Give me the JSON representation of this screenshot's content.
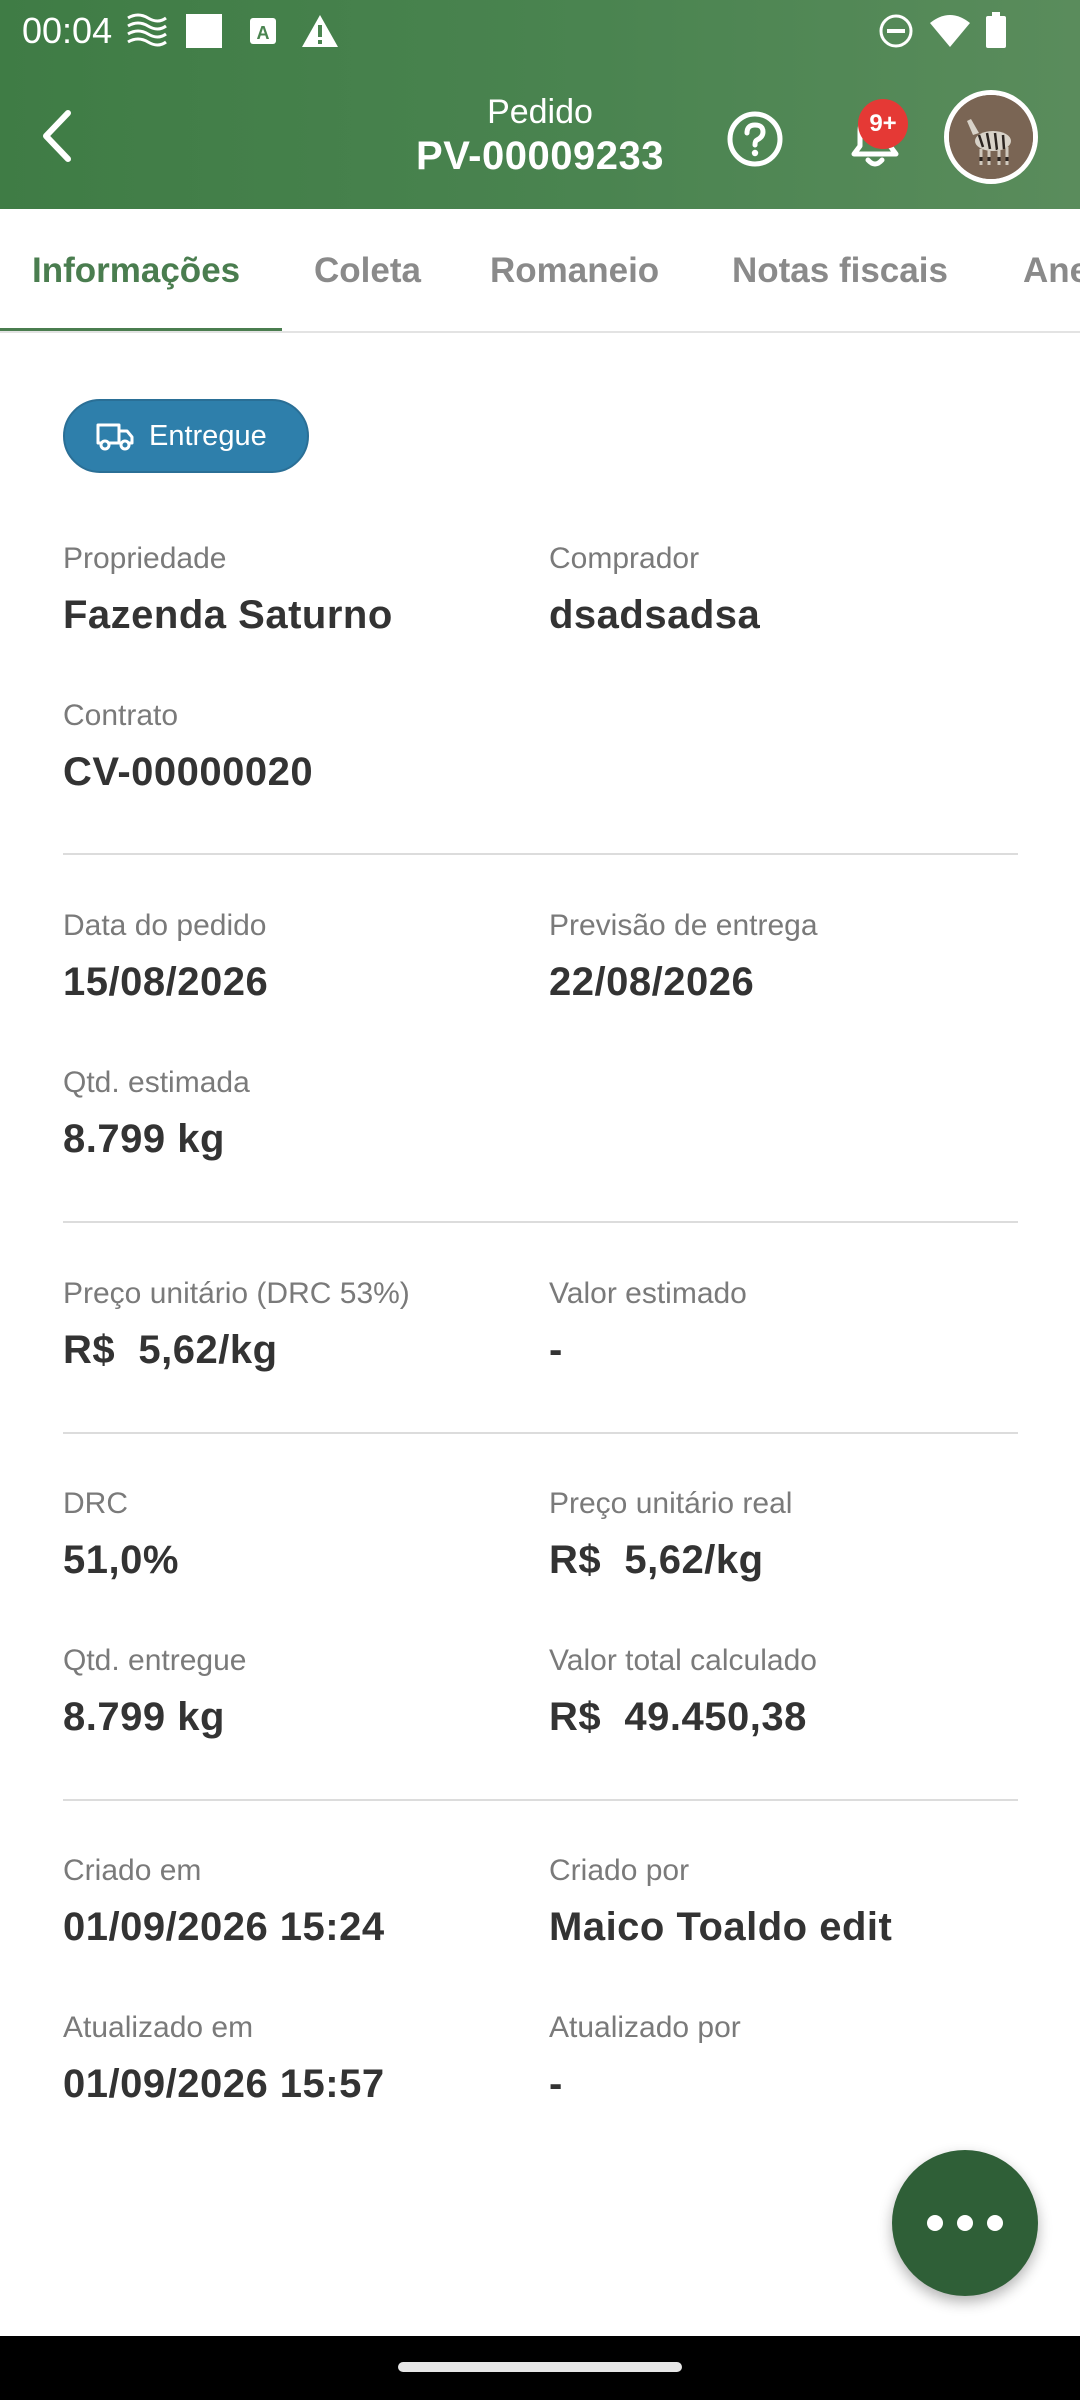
{
  "status_bar": {
    "time": "00:04"
  },
  "app_bar": {
    "title_small": "Pedido",
    "title_main": "PV-00009233",
    "notification_badge": "9+"
  },
  "tabs": [
    {
      "label": "Informações",
      "active": true
    },
    {
      "label": "Coleta",
      "active": false
    },
    {
      "label": "Romaneio",
      "active": false
    },
    {
      "label": "Notas fiscais",
      "active": false
    },
    {
      "label": "Anexos",
      "active": false
    }
  ],
  "status_chip": {
    "label": "Entregue",
    "icon": "truck-icon",
    "color": "#2e7fab"
  },
  "sections": {
    "propriedade": {
      "label": "Propriedade",
      "value": "Fazenda Saturno"
    },
    "comprador": {
      "label": "Comprador",
      "value": "dsadsadsa"
    },
    "contrato": {
      "label": "Contrato",
      "value": "CV-00000020"
    },
    "data_pedido": {
      "label": "Data do pedido",
      "value": "15/08/2026"
    },
    "previsao_entrega": {
      "label": "Previsão de entrega",
      "value": "22/08/2026"
    },
    "qtd_estimada": {
      "label": "Qtd. estimada",
      "value": "8.799 kg"
    },
    "preco_unitario": {
      "label": "Preço unitário (DRC 53%)",
      "value": "R$  5,62/kg"
    },
    "valor_estimado": {
      "label": "Valor estimado",
      "value": "-"
    },
    "drc": {
      "label": "DRC",
      "value": "51,0%"
    },
    "preco_unitario_real": {
      "label": "Preço unitário real",
      "value": "R$  5,62/kg"
    },
    "qtd_entregue": {
      "label": "Qtd. entregue",
      "value": "8.799 kg"
    },
    "valor_total": {
      "label": "Valor total calculado",
      "value": "R$  49.450,38"
    },
    "criado_em": {
      "label": "Criado em",
      "value": "01/09/2026 15:24"
    },
    "criado_por": {
      "label": "Criado por",
      "value": "Maico Toaldo edit"
    },
    "atualizado_em": {
      "label": "Atualizado em",
      "value": "01/09/2026 15:57"
    },
    "atualizado_por": {
      "label": "Atualizado por",
      "value": "-"
    }
  },
  "colors": {
    "primary": "#4a7d4f",
    "fab": "#2f5f37",
    "badge": "#e53935"
  }
}
